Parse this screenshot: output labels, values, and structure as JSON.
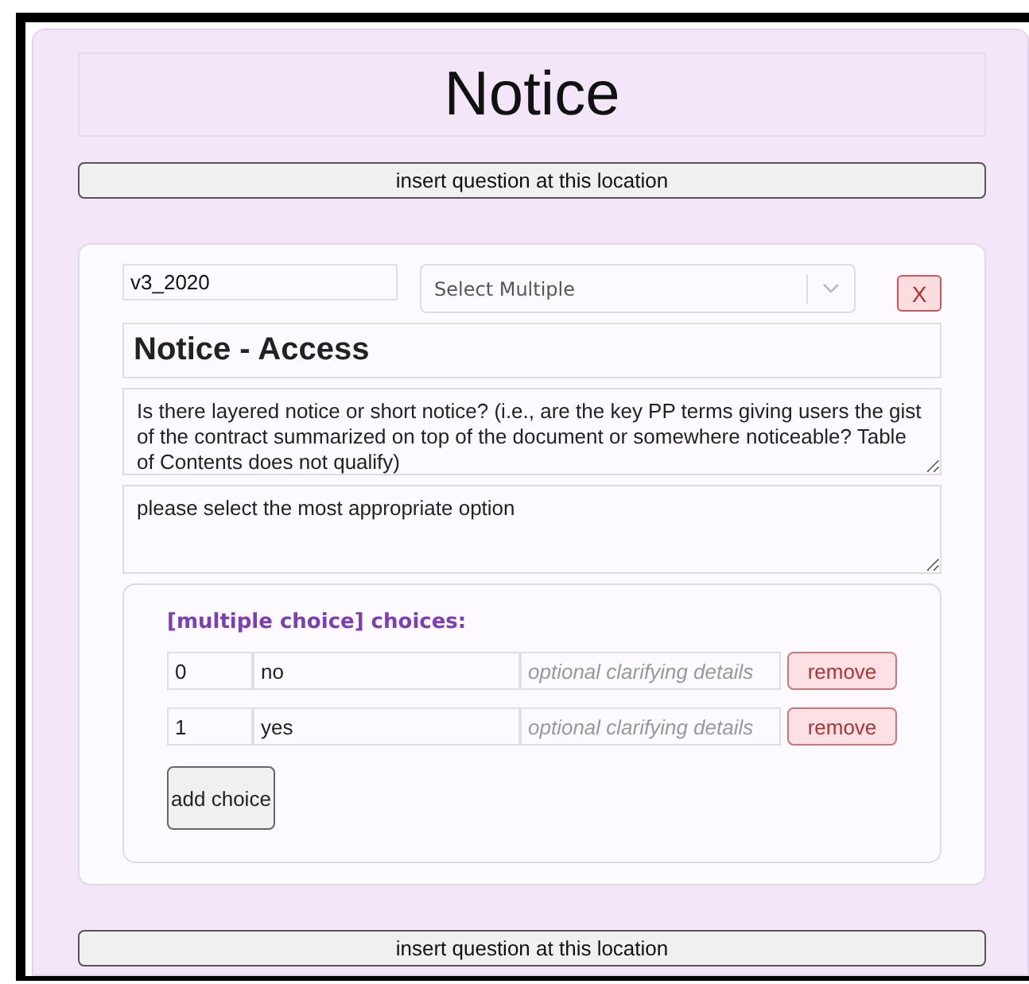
{
  "section_title": "Notice",
  "insert_buttons": [
    {
      "label": "insert question at this location"
    },
    {
      "label": "insert question at this location"
    }
  ],
  "question": {
    "version": "v3_2020",
    "type_select": {
      "value": "Select Multiple"
    },
    "delete_label": "X",
    "title": "Notice - Access",
    "description": "Is there layered notice or short notice? (i.e., are the key PP terms giving users the gist of the contract summarized on top of the document or somewhere noticeable? Table of Contents does not qualify)",
    "instructions": "please select the most appropriate option",
    "choices_heading": "[multiple choice] choices:",
    "choices": [
      {
        "value": "0",
        "label": "no",
        "details_placeholder": "optional clarifying details",
        "remove_label": "remove"
      },
      {
        "value": "1",
        "label": "yes",
        "details_placeholder": "optional clarifying details",
        "remove_label": "remove"
      }
    ],
    "add_choice_label": "add choice"
  }
}
